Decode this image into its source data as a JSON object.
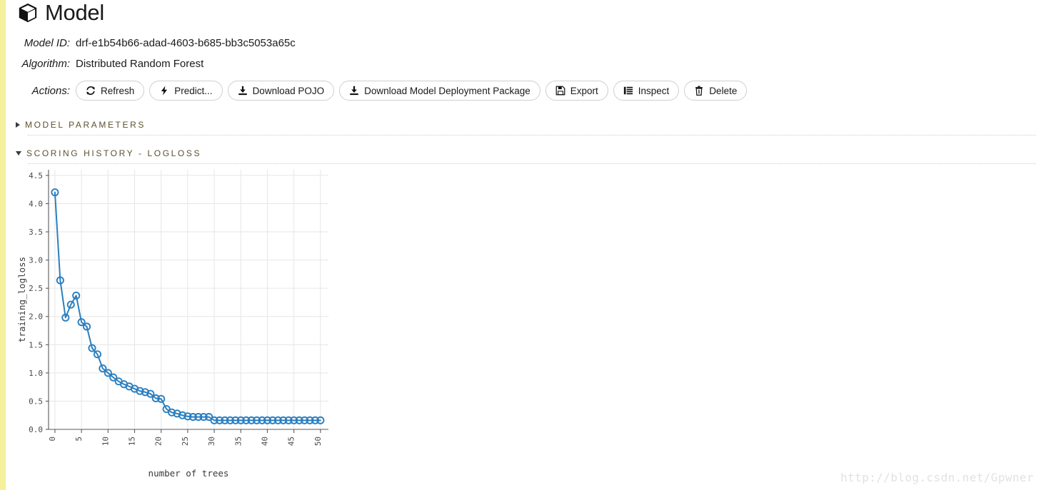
{
  "header": {
    "icon": "cube-icon",
    "title": "Model"
  },
  "meta": {
    "model_id_label": "Model ID:",
    "model_id_value": "drf-e1b54b66-adad-4603-b685-bb3c5053a65c",
    "algorithm_label": "Algorithm:",
    "algorithm_value": "Distributed Random Forest",
    "actions_label": "Actions:"
  },
  "actions": [
    {
      "label": "Refresh",
      "icon": "refresh-icon"
    },
    {
      "label": "Predict...",
      "icon": "bolt-icon"
    },
    {
      "label": "Download POJO",
      "icon": "download-icon"
    },
    {
      "label": "Download Model Deployment Package",
      "icon": "download-icon"
    },
    {
      "label": "Export",
      "icon": "floppy-disk-icon"
    },
    {
      "label": "Inspect",
      "icon": "list-icon"
    },
    {
      "label": "Delete",
      "icon": "trash-icon"
    }
  ],
  "sections": [
    {
      "title": "MODEL PARAMETERS",
      "expanded": false,
      "toggle_icon": "triangle-right-icon"
    },
    {
      "title": "SCORING HISTORY - LOGLOSS",
      "expanded": true,
      "toggle_icon": "triangle-down-icon"
    }
  ],
  "colors": {
    "accent_strip": "#f5f09b",
    "series": "#2b7fc0",
    "section_title": "#5c5030",
    "grid": "#e6e6e6",
    "watermark": "#e2e2e2"
  },
  "watermark": "http://blog.csdn.net/Gpwner",
  "chart_data": {
    "type": "line",
    "title": "",
    "xlabel": "number of trees",
    "ylabel": "training_logloss",
    "xlim": [
      -1.2,
      51.5
    ],
    "ylim": [
      0.0,
      4.6
    ],
    "xticks": [
      0,
      5,
      10,
      15,
      20,
      25,
      30,
      35,
      40,
      45,
      50
    ],
    "yticks": [
      0.0,
      0.5,
      1.0,
      1.5,
      2.0,
      2.5,
      3.0,
      3.5,
      4.0,
      4.5
    ],
    "xtick_labels": [
      "0",
      "5",
      "10",
      "15",
      "20",
      "25",
      "30",
      "35",
      "40",
      "45",
      "50"
    ],
    "ytick_labels": [
      "0.0",
      "0.5",
      "1.0",
      "1.5",
      "2.0",
      "2.5",
      "3.0",
      "3.5",
      "4.0",
      "4.5"
    ],
    "grid": true,
    "legend": "none",
    "marker": "open-circle",
    "series": [
      {
        "name": "training_logloss",
        "color": "#2b7fc0",
        "x": [
          0,
          1,
          2,
          3,
          4,
          5,
          6,
          7,
          8,
          9,
          10,
          11,
          12,
          13,
          14,
          15,
          16,
          17,
          18,
          19,
          20,
          21,
          22,
          23,
          24,
          25,
          26,
          27,
          28,
          29,
          30,
          31,
          32,
          33,
          34,
          35,
          36,
          37,
          38,
          39,
          40,
          41,
          42,
          43,
          44,
          45,
          46,
          47,
          48,
          49,
          50
        ],
        "y": [
          4.2,
          2.64,
          1.98,
          2.21,
          2.37,
          1.9,
          1.82,
          1.44,
          1.33,
          1.08,
          1.0,
          0.92,
          0.85,
          0.8,
          0.76,
          0.72,
          0.68,
          0.66,
          0.63,
          0.55,
          0.54,
          0.36,
          0.3,
          0.28,
          0.25,
          0.23,
          0.22,
          0.22,
          0.22,
          0.22,
          0.16,
          0.16,
          0.16,
          0.16,
          0.16,
          0.16,
          0.16,
          0.16,
          0.16,
          0.16,
          0.16,
          0.16,
          0.16,
          0.16,
          0.16,
          0.16,
          0.16,
          0.16,
          0.16,
          0.16,
          0.16
        ]
      }
    ]
  }
}
